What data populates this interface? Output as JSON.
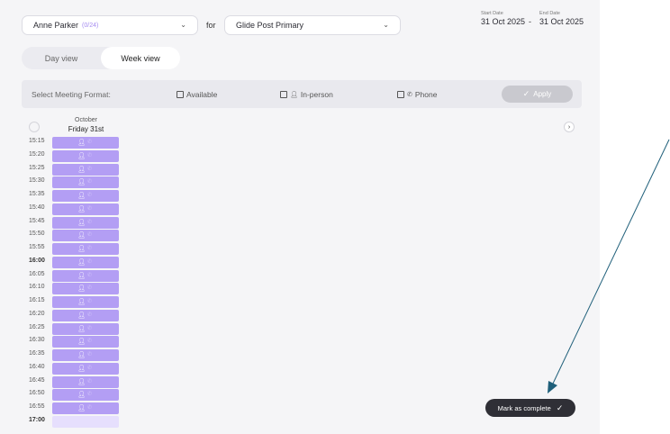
{
  "filters": {
    "staff": {
      "name": "Anne Parker",
      "count": "(0/24)"
    },
    "for_label": "for",
    "school": {
      "name": "Glide Post Primary"
    }
  },
  "dates": {
    "start_label": "Start Date",
    "start_value": "31 Oct 2025",
    "separator": "-",
    "end_label": "End Date",
    "end_value": "31 Oct 2025"
  },
  "view_toggle": {
    "day": "Day view",
    "week": "Week view",
    "selected": "week"
  },
  "meeting_format": {
    "label": "Select Meeting Format:",
    "options": [
      {
        "label": "Available",
        "icon": "none",
        "checked": false
      },
      {
        "label": "In-person",
        "icon": "person-icon",
        "checked": false
      },
      {
        "label": "Phone",
        "icon": "phone-icon",
        "checked": false
      }
    ],
    "apply_label": "Apply"
  },
  "calendar": {
    "month": "October",
    "day": "Friday 31st",
    "times": [
      {
        "label": "15:15",
        "hour": false,
        "faded": false
      },
      {
        "label": "15:20",
        "hour": false,
        "faded": false
      },
      {
        "label": "15:25",
        "hour": false,
        "faded": false
      },
      {
        "label": "15:30",
        "hour": false,
        "faded": false
      },
      {
        "label": "15:35",
        "hour": false,
        "faded": false
      },
      {
        "label": "15:40",
        "hour": false,
        "faded": false
      },
      {
        "label": "15:45",
        "hour": false,
        "faded": false
      },
      {
        "label": "15:50",
        "hour": false,
        "faded": false
      },
      {
        "label": "15:55",
        "hour": false,
        "faded": false
      },
      {
        "label": "16:00",
        "hour": true,
        "faded": false
      },
      {
        "label": "16:05",
        "hour": false,
        "faded": false
      },
      {
        "label": "16:10",
        "hour": false,
        "faded": false
      },
      {
        "label": "16:15",
        "hour": false,
        "faded": false
      },
      {
        "label": "16:20",
        "hour": false,
        "faded": false
      },
      {
        "label": "16:25",
        "hour": false,
        "faded": false
      },
      {
        "label": "16:30",
        "hour": false,
        "faded": false
      },
      {
        "label": "16:35",
        "hour": false,
        "faded": false
      },
      {
        "label": "16:40",
        "hour": false,
        "faded": false
      },
      {
        "label": "16:45",
        "hour": false,
        "faded": false
      },
      {
        "label": "16:50",
        "hour": false,
        "faded": false
      },
      {
        "label": "16:55",
        "hour": false,
        "faded": false
      },
      {
        "label": "17:00",
        "hour": true,
        "faded": true
      }
    ]
  },
  "mark_complete_label": "Mark as complete",
  "colors": {
    "slot": "#b39ef4",
    "accent_count": "#a58bf0",
    "arrow": "#1f5f7a",
    "dark_button": "#2f2f36"
  }
}
